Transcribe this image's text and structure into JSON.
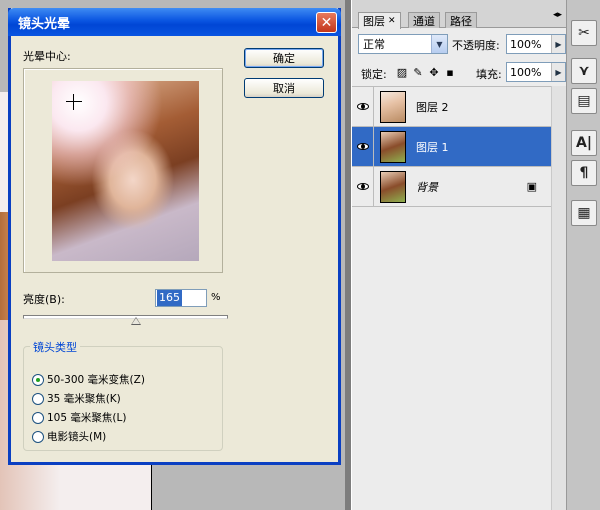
{
  "dialog": {
    "title": "镜头光晕",
    "close_glyph": "✕",
    "flare_center_label": "光晕中心:",
    "ok_label": "确定",
    "cancel_label": "取消",
    "brightness_label": "亮度(B):",
    "brightness_value": "165",
    "brightness_unit": "%",
    "brightness_slider_fraction": 0.55,
    "lens_type_title": "镜头类型",
    "lens_options": [
      {
        "label": "50-300 毫米变焦(Z)",
        "selected": true
      },
      {
        "label": "35 毫米聚焦(K)",
        "selected": false
      },
      {
        "label": "105 毫米聚焦(L)",
        "selected": false
      },
      {
        "label": "电影镜头(M)",
        "selected": false
      }
    ]
  },
  "layers_panel": {
    "tabs": [
      {
        "label": "图层",
        "active": true,
        "closable": true
      },
      {
        "label": "通道",
        "active": false
      },
      {
        "label": "路径",
        "active": false
      }
    ],
    "blend_mode": "正常",
    "opacity_label": "不透明度:",
    "opacity_value": "100%",
    "lock_label": "锁定:",
    "fill_label": "填充:",
    "fill_value": "100%",
    "layers": [
      {
        "name": "图层 2",
        "selected": false,
        "italic": false,
        "locked": false
      },
      {
        "name": "图层 1",
        "selected": true,
        "italic": false,
        "locked": false
      },
      {
        "name": "背景",
        "selected": false,
        "italic": true,
        "locked": true
      }
    ]
  },
  "tool_strip": {
    "icons": [
      "tools-icon",
      "brush-icon",
      "swatches-icon",
      "character-icon",
      "paragraph-icon",
      "notes-icon"
    ],
    "glyphs": [
      "✂",
      "⋎",
      "▤",
      "A|",
      "¶",
      "▦"
    ]
  }
}
